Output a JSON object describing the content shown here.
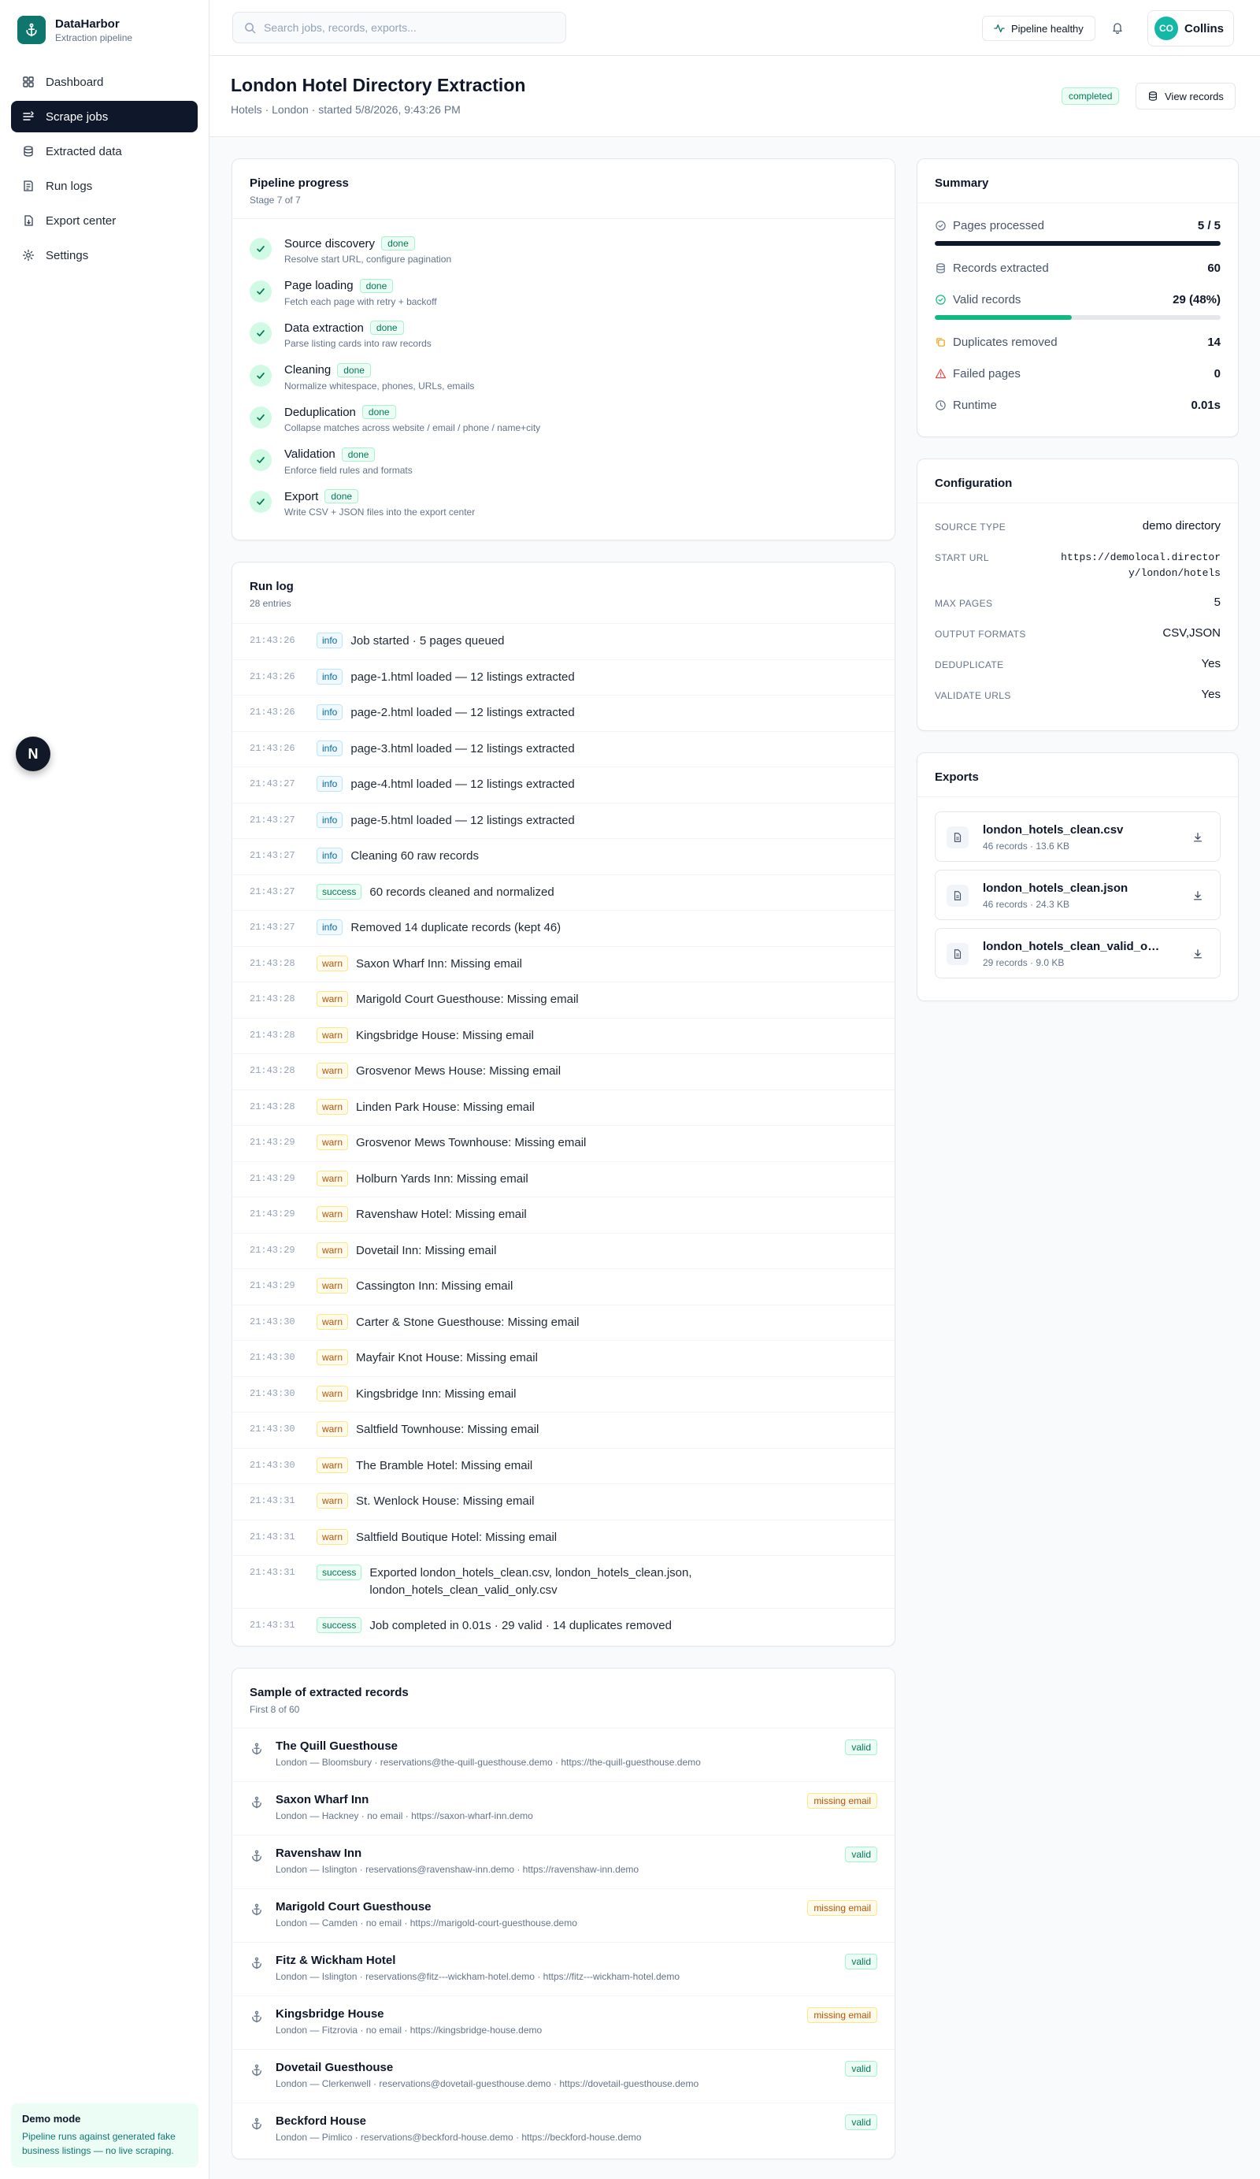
{
  "brand": {
    "name": "DataHarbor",
    "subtitle": "Extraction pipeline"
  },
  "nav": [
    {
      "label": "Dashboard",
      "icon": "dashboard-icon",
      "active": false
    },
    {
      "label": "Scrape jobs",
      "icon": "jobs-icon",
      "active": true
    },
    {
      "label": "Extracted data",
      "icon": "database-icon",
      "active": false
    },
    {
      "label": "Run logs",
      "icon": "logs-icon",
      "active": false
    },
    {
      "label": "Export center",
      "icon": "export-icon",
      "active": false
    },
    {
      "label": "Settings",
      "icon": "gear-icon",
      "active": false
    }
  ],
  "demo": {
    "title": "Demo mode",
    "text": "Pipeline runs against generated fake business listings — no live scraping."
  },
  "floating_button": "N",
  "topbar": {
    "search_placeholder": "Search jobs, records, exports...",
    "health": "Pipeline healthy",
    "user_initials": "CO",
    "user_name": "Collins"
  },
  "header": {
    "title": "London Hotel Directory Extraction",
    "subtitle": "Hotels · London · started 5/8/2026, 9:43:26 PM",
    "status": "completed",
    "view_button": "View records"
  },
  "colors": {
    "accent": "#0f766e",
    "success": "#10b981",
    "warn": "#f59e0b",
    "danger": "#ef4444",
    "dark": "#0f172a"
  },
  "pipeline": {
    "title": "Pipeline progress",
    "subtitle": "Stage 7 of 7",
    "stages": [
      {
        "name": "Source discovery",
        "status": "done",
        "desc": "Resolve start URL, configure pagination"
      },
      {
        "name": "Page loading",
        "status": "done",
        "desc": "Fetch each page with retry + backoff"
      },
      {
        "name": "Data extraction",
        "status": "done",
        "desc": "Parse listing cards into raw records"
      },
      {
        "name": "Cleaning",
        "status": "done",
        "desc": "Normalize whitespace, phones, URLs, emails"
      },
      {
        "name": "Deduplication",
        "status": "done",
        "desc": "Collapse matches across website / email / phone / name+city"
      },
      {
        "name": "Validation",
        "status": "done",
        "desc": "Enforce field rules and formats"
      },
      {
        "name": "Export",
        "status": "done",
        "desc": "Write CSV + JSON files into the export center"
      }
    ]
  },
  "runlog": {
    "title": "Run log",
    "subtitle": "28 entries",
    "entries": [
      {
        "time": "21:43:26",
        "level": "info",
        "msg": "Job started · 5 pages queued"
      },
      {
        "time": "21:43:26",
        "level": "info",
        "msg": "page-1.html loaded — 12 listings extracted"
      },
      {
        "time": "21:43:26",
        "level": "info",
        "msg": "page-2.html loaded — 12 listings extracted"
      },
      {
        "time": "21:43:26",
        "level": "info",
        "msg": "page-3.html loaded — 12 listings extracted"
      },
      {
        "time": "21:43:27",
        "level": "info",
        "msg": "page-4.html loaded — 12 listings extracted"
      },
      {
        "time": "21:43:27",
        "level": "info",
        "msg": "page-5.html loaded — 12 listings extracted"
      },
      {
        "time": "21:43:27",
        "level": "info",
        "msg": "Cleaning 60 raw records"
      },
      {
        "time": "21:43:27",
        "level": "success",
        "msg": "60 records cleaned and normalized"
      },
      {
        "time": "21:43:27",
        "level": "info",
        "msg": "Removed 14 duplicate records (kept 46)"
      },
      {
        "time": "21:43:28",
        "level": "warn",
        "msg": "Saxon Wharf Inn: Missing email"
      },
      {
        "time": "21:43:28",
        "level": "warn",
        "msg": "Marigold Court Guesthouse: Missing email"
      },
      {
        "time": "21:43:28",
        "level": "warn",
        "msg": "Kingsbridge House: Missing email"
      },
      {
        "time": "21:43:28",
        "level": "warn",
        "msg": "Grosvenor Mews House: Missing email"
      },
      {
        "time": "21:43:28",
        "level": "warn",
        "msg": "Linden Park House: Missing email"
      },
      {
        "time": "21:43:29",
        "level": "warn",
        "msg": "Grosvenor Mews Townhouse: Missing email"
      },
      {
        "time": "21:43:29",
        "level": "warn",
        "msg": "Holburn Yards Inn: Missing email"
      },
      {
        "time": "21:43:29",
        "level": "warn",
        "msg": "Ravenshaw Hotel: Missing email"
      },
      {
        "time": "21:43:29",
        "level": "warn",
        "msg": "Dovetail Inn: Missing email"
      },
      {
        "time": "21:43:29",
        "level": "warn",
        "msg": "Cassington Inn: Missing email"
      },
      {
        "time": "21:43:30",
        "level": "warn",
        "msg": "Carter & Stone Guesthouse: Missing email"
      },
      {
        "time": "21:43:30",
        "level": "warn",
        "msg": "Mayfair Knot House: Missing email"
      },
      {
        "time": "21:43:30",
        "level": "warn",
        "msg": "Kingsbridge Inn: Missing email"
      },
      {
        "time": "21:43:30",
        "level": "warn",
        "msg": "Saltfield Townhouse: Missing email"
      },
      {
        "time": "21:43:30",
        "level": "warn",
        "msg": "The Bramble Hotel: Missing email"
      },
      {
        "time": "21:43:31",
        "level": "warn",
        "msg": "St. Wenlock House: Missing email"
      },
      {
        "time": "21:43:31",
        "level": "warn",
        "msg": "Saltfield Boutique Hotel: Missing email"
      },
      {
        "time": "21:43:31",
        "level": "success",
        "msg": "Exported london_hotels_clean.csv, london_hotels_clean.json, london_hotels_clean_valid_only.csv"
      },
      {
        "time": "21:43:31",
        "level": "success",
        "msg": "Job completed in 0.01s · 29 valid · 14 duplicates removed"
      }
    ]
  },
  "records": {
    "title": "Sample of extracted records",
    "subtitle": "First 8 of 60",
    "items": [
      {
        "name": "The Quill Guesthouse",
        "detail": "London — Bloomsbury · reservations@the-quill-guesthouse.demo · https://the-quill-guesthouse.demo",
        "status": "valid"
      },
      {
        "name": "Saxon Wharf Inn",
        "detail": "London — Hackney · no email · https://saxon-wharf-inn.demo",
        "status": "missing email"
      },
      {
        "name": "Ravenshaw Inn",
        "detail": "London — Islington · reservations@ravenshaw-inn.demo · https://ravenshaw-inn.demo",
        "status": "valid"
      },
      {
        "name": "Marigold Court Guesthouse",
        "detail": "London — Camden · no email · https://marigold-court-guesthouse.demo",
        "status": "missing email"
      },
      {
        "name": "Fitz & Wickham Hotel",
        "detail": "London — Islington · reservations@fitz---wickham-hotel.demo · https://fitz---wickham-hotel.demo",
        "status": "valid"
      },
      {
        "name": "Kingsbridge House",
        "detail": "London — Fitzrovia · no email · https://kingsbridge-house.demo",
        "status": "missing email"
      },
      {
        "name": "Dovetail Guesthouse",
        "detail": "London — Clerkenwell · reservations@dovetail-guesthouse.demo · https://dovetail-guesthouse.demo",
        "status": "valid"
      },
      {
        "name": "Beckford House",
        "detail": "London — Pimlico · reservations@beckford-house.demo · https://beckford-house.demo",
        "status": "valid"
      }
    ]
  },
  "summary": {
    "title": "Summary",
    "pages_label": "Pages processed",
    "pages_value": "5 / 5",
    "pages_progress": 1.0,
    "records_label": "Records extracted",
    "records_value": "60",
    "valid_label": "Valid records",
    "valid_value": "29 (48%)",
    "valid_progress": 0.48,
    "dup_label": "Duplicates removed",
    "dup_value": "14",
    "failed_label": "Failed pages",
    "failed_value": "0",
    "runtime_label": "Runtime",
    "runtime_value": "0.01s"
  },
  "config": {
    "title": "Configuration",
    "rows": [
      {
        "key": "SOURCE TYPE",
        "value": "demo directory",
        "mono": false
      },
      {
        "key": "START URL",
        "value": "https://demolocal.directory/london/hotels",
        "mono": true
      },
      {
        "key": "MAX PAGES",
        "value": "5",
        "mono": false
      },
      {
        "key": "OUTPUT FORMATS",
        "value": "CSV,JSON",
        "mono": false
      },
      {
        "key": "DEDUPLICATE",
        "value": "Yes",
        "mono": false
      },
      {
        "key": "VALIDATE URLS",
        "value": "Yes",
        "mono": false
      }
    ]
  },
  "exports": {
    "title": "Exports",
    "files": [
      {
        "name": "london_hotels_clean.csv",
        "meta": "46 records · 13.6 KB"
      },
      {
        "name": "london_hotels_clean.json",
        "meta": "46 records · 24.3 KB"
      },
      {
        "name": "london_hotels_clean_valid_only.csv",
        "meta": "29 records · 9.0 KB"
      }
    ]
  }
}
